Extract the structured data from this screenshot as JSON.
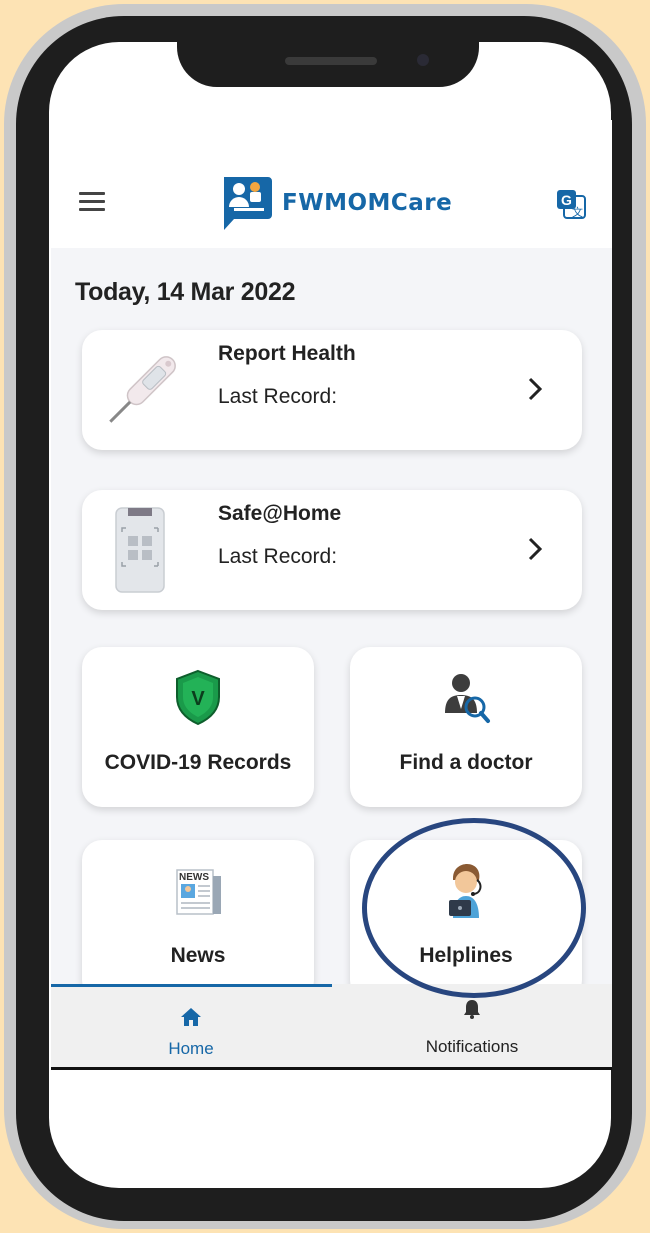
{
  "app": {
    "name": "FWMOMCare",
    "date_title": "Today, 14 Mar 2022"
  },
  "cards": [
    {
      "title": "Report Health",
      "subtitle": "Last Record:",
      "icon": "thermometer-icon"
    },
    {
      "title": "Safe@Home",
      "subtitle": "Last Record:",
      "icon": "safe-home-device-icon"
    }
  ],
  "tiles": [
    {
      "label": "COVID-19 Records",
      "icon": "shield-v-icon"
    },
    {
      "label": "Find a doctor",
      "icon": "doctor-search-icon"
    },
    {
      "label": "News",
      "icon": "newspaper-icon"
    },
    {
      "label": "Helplines",
      "icon": "helpline-agent-icon"
    }
  ],
  "bottom_nav": {
    "home_label": "Home",
    "notifications_label": "Notifications"
  },
  "colors": {
    "brand": "#1667a7",
    "accent_ring": "#28467f",
    "page_background": "#fde3b4",
    "shield_green": "#1a9a4a"
  }
}
